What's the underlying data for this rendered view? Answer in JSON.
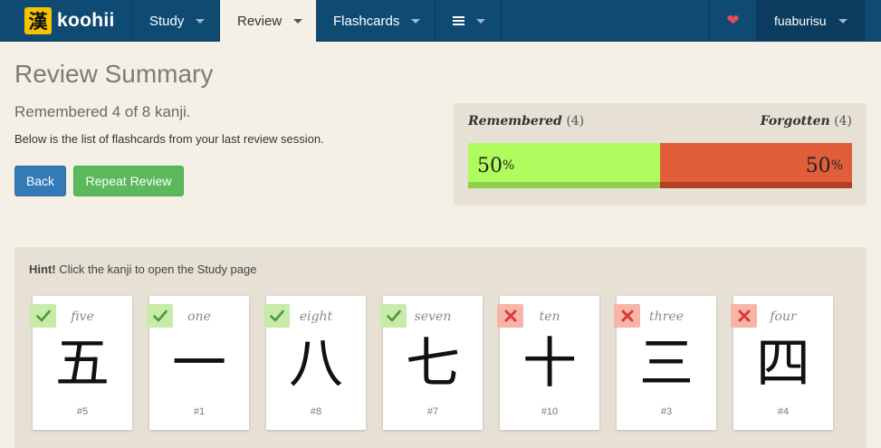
{
  "navbar": {
    "logo_glyph": "漢",
    "brand": "koohii",
    "items": [
      {
        "label": "Study"
      },
      {
        "label": "Review"
      },
      {
        "label": "Flashcards"
      }
    ],
    "menu_icon": "hamburger-icon",
    "favorite_icon": "heart-icon",
    "username": "fuaburisu"
  },
  "summary": {
    "title": "Review Summary",
    "remembered_line": "Remembered 4 of 8 kanji.",
    "description": "Below is the list of flashcards from your last review session.",
    "back_label": "Back",
    "repeat_label": "Repeat Review"
  },
  "stats": {
    "remembered_label": "Remembered",
    "remembered_count": "(4)",
    "forgotten_label": "Forgotten",
    "forgotten_count": "(4)",
    "remembered_pct_num": "50",
    "forgotten_pct_num": "50",
    "pct_sign": "%",
    "remembered_fraction": 0.5,
    "colors": {
      "remembered": "#b0fc5e",
      "forgotten": "#e05e3a"
    }
  },
  "hint": {
    "bold": "Hint!",
    "text": " Click the kanji to open the Study page"
  },
  "cards": [
    {
      "keyword": "five",
      "kanji": "五",
      "number": "#5",
      "status": "remembered",
      "icon": "check-icon"
    },
    {
      "keyword": "one",
      "kanji": "一",
      "number": "#1",
      "status": "remembered",
      "icon": "check-icon"
    },
    {
      "keyword": "eight",
      "kanji": "八",
      "number": "#8",
      "status": "remembered",
      "icon": "check-icon"
    },
    {
      "keyword": "seven",
      "kanji": "七",
      "number": "#7",
      "status": "remembered",
      "icon": "check-icon"
    },
    {
      "keyword": "ten",
      "kanji": "十",
      "number": "#10",
      "status": "forgotten",
      "icon": "cross-icon"
    },
    {
      "keyword": "three",
      "kanji": "三",
      "number": "#3",
      "status": "forgotten",
      "icon": "cross-icon"
    },
    {
      "keyword": "four",
      "kanji": "四",
      "number": "#4",
      "status": "forgotten",
      "icon": "cross-icon"
    }
  ]
}
